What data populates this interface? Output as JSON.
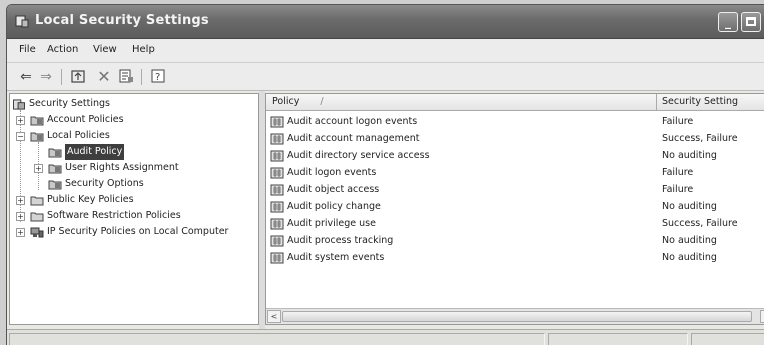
{
  "window": {
    "title": "Local Security Settings",
    "controls": {
      "minimize": "_",
      "close": "✕"
    }
  },
  "menu": {
    "items": [
      {
        "label": "File"
      },
      {
        "label": "Action"
      },
      {
        "label": "View"
      },
      {
        "label": "Help"
      }
    ]
  },
  "toolbar": {
    "icons": [
      "back-icon",
      "forward-icon",
      "up-one-level-icon",
      "delete-icon",
      "properties-icon",
      "help-icon"
    ]
  },
  "tree": {
    "root": "Security Settings",
    "items": [
      {
        "label": "Account Policies",
        "expander": "+"
      },
      {
        "label": "Local Policies",
        "expander": "−"
      },
      {
        "label": "Audit Policy",
        "selected": true
      },
      {
        "label": "User Rights Assignment",
        "expander": "+"
      },
      {
        "label": "Security Options"
      },
      {
        "label": "Public Key Policies",
        "expander": "+"
      },
      {
        "label": "Software Restriction Policies",
        "expander": "+"
      },
      {
        "label": "IP Security Policies on Local Computer",
        "expander": "+"
      }
    ]
  },
  "list": {
    "columns": {
      "policy": "Policy",
      "sort_indicator": "/",
      "setting": "Security Setting"
    },
    "rows": [
      {
        "policy": "Audit account logon events",
        "setting": "Failure"
      },
      {
        "policy": "Audit account management",
        "setting": "Success, Failure"
      },
      {
        "policy": "Audit directory service access",
        "setting": "No auditing"
      },
      {
        "policy": "Audit logon events",
        "setting": "Failure"
      },
      {
        "policy": "Audit object access",
        "setting": "Failure"
      },
      {
        "policy": "Audit policy change",
        "setting": "No auditing"
      },
      {
        "policy": "Audit privilege use",
        "setting": "Success, Failure"
      },
      {
        "policy": "Audit process tracking",
        "setting": "No auditing"
      },
      {
        "policy": "Audit system events",
        "setting": "No auditing"
      }
    ]
  },
  "scrollbar": {
    "left": "<",
    "right": ">"
  },
  "colors": {
    "selection": "#3e3e3e",
    "titlebar": "#6a6a6a"
  }
}
